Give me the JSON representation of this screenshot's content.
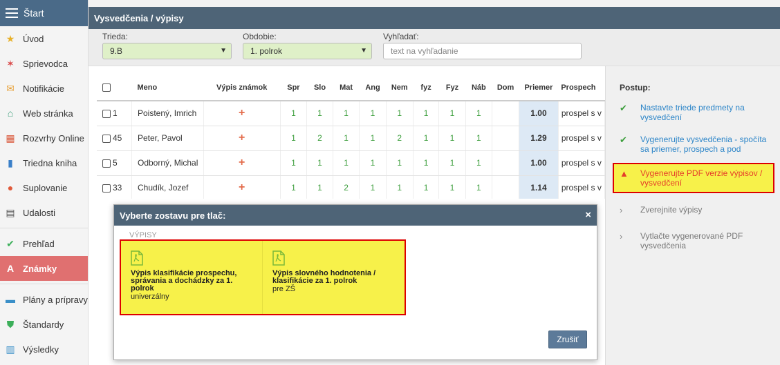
{
  "sidebar": {
    "header": "Štart",
    "items": [
      {
        "label": "Úvod",
        "icon": "star-icon",
        "glyph": "★",
        "color": "#e8b12a"
      },
      {
        "label": "Sprievodca",
        "icon": "wand-icon",
        "glyph": "✶",
        "color": "#d94a4a"
      },
      {
        "label": "Notifikácie",
        "icon": "envelope-icon",
        "glyph": "✉",
        "color": "#e8a23a"
      },
      {
        "label": "Web stránka",
        "icon": "home-icon",
        "glyph": "⌂",
        "color": "#3c9e7a"
      },
      {
        "label": "Rozvrhy Online",
        "icon": "grid-icon",
        "glyph": "▦",
        "color": "#d9573a"
      },
      {
        "label": "Triedna kniha",
        "icon": "book-icon",
        "glyph": "▮",
        "color": "#3a7fc8"
      },
      {
        "label": "Suplovanie",
        "icon": "user-icon",
        "glyph": "●",
        "color": "#e05a3a"
      },
      {
        "label": "Udalosti",
        "icon": "calendar-icon",
        "glyph": "▤",
        "color": "#555"
      },
      {
        "label": "Prehľad",
        "icon": "check-circle-icon",
        "glyph": "✔",
        "color": "#3caf5a"
      },
      {
        "label": "Známky",
        "icon": "grade-icon",
        "glyph": "A",
        "color": "#e07070"
      },
      {
        "label": "Plány a prípravy",
        "icon": "briefcase-icon",
        "glyph": "▬",
        "color": "#3a8fc8"
      },
      {
        "label": "Štandardy",
        "icon": "shield-icon",
        "glyph": "⛊",
        "color": "#3caf5a"
      },
      {
        "label": "Výsledky",
        "icon": "bar-chart-icon",
        "glyph": "▥",
        "color": "#3a8fc8"
      }
    ]
  },
  "window": {
    "title": "Vysvedčenia / výpisy"
  },
  "filters": {
    "class_label": "Trieda:",
    "class_value": "9.B",
    "period_label": "Obdobie:",
    "period_value": "1. polrok",
    "search_label": "Vyhľadať:",
    "search_placeholder": "text na vyhľadanie"
  },
  "table": {
    "headers": [
      "Meno",
      "Výpis známok",
      "Spr",
      "Slo",
      "Mat",
      "Ang",
      "Nem",
      "fyz",
      "Fyz",
      "Náb",
      "Dom",
      "Priemer",
      "Prospech"
    ],
    "rows": [
      {
        "num": "1",
        "name": "Poistený, Imrich",
        "plus": "+",
        "grades": [
          "1",
          "1",
          "1",
          "1",
          "1",
          "1",
          "1",
          "1",
          ""
        ],
        "avg": "1.00",
        "result": "prospel s v"
      },
      {
        "num": "45",
        "name": "Peter, Pavol",
        "plus": "+",
        "grades": [
          "1",
          "2",
          "1",
          "1",
          "2",
          "1",
          "1",
          "1",
          ""
        ],
        "avg": "1.29",
        "result": "prospel s v"
      },
      {
        "num": "5",
        "name": "Odborný, Michal",
        "plus": "+",
        "grades": [
          "1",
          "1",
          "1",
          "1",
          "1",
          "1",
          "1",
          "1",
          ""
        ],
        "avg": "1.00",
        "result": "prospel s v"
      },
      {
        "num": "33",
        "name": "Chudík, Jozef",
        "plus": "+",
        "grades": [
          "1",
          "1",
          "2",
          "1",
          "1",
          "1",
          "1",
          "1",
          ""
        ],
        "avg": "1.14",
        "result": "prospel s v"
      }
    ]
  },
  "steps": {
    "title": "Postup:",
    "items": [
      {
        "text": "Nastavte triede predmety na vysvedčení",
        "state": "done"
      },
      {
        "text": "Vygenerujte vysvedčenia - spočíta sa priemer, prospech a pod",
        "state": "done"
      },
      {
        "text": "Vygenerujte PDF verzie výpisov / vysvedčení",
        "state": "warn"
      },
      {
        "text": "Zverejnite výpisy",
        "state": "todo"
      },
      {
        "text": "Vytlačte vygenerované PDF vysvedčenia",
        "state": "todo"
      }
    ]
  },
  "modal": {
    "title": "Vyberte zostavu pre tlač:",
    "close": "×",
    "section": "VÝPISY",
    "reports": [
      {
        "title": "Výpis klasifikácie prospechu, správania a dochádzky za 1. polrok",
        "subtitle": "univerzálny",
        "icon": "pdf-icon"
      },
      {
        "title": "Výpis slovného hodnotenia / klasifikácie za 1. polrok",
        "subtitle": "pre ZŠ",
        "icon": "pdf-icon"
      }
    ],
    "cancel": "Zrušiť"
  }
}
